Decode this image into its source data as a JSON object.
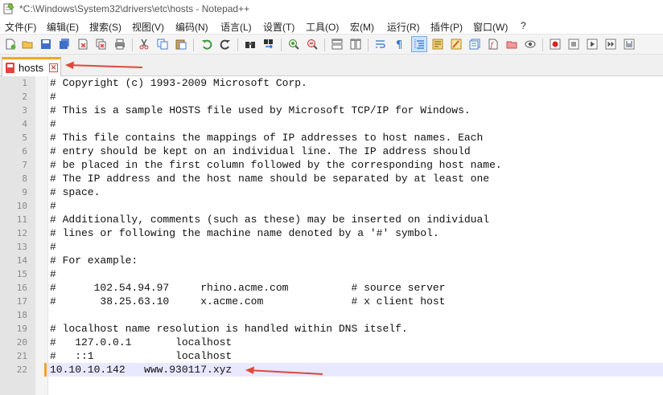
{
  "window": {
    "title": "*C:\\Windows\\System32\\drivers\\etc\\hosts - Notepad++",
    "icon": "notepadpp-icon"
  },
  "menu": [
    {
      "label": "文件(F)"
    },
    {
      "label": "编辑(E)"
    },
    {
      "label": "搜索(S)"
    },
    {
      "label": "视图(V)"
    },
    {
      "label": "编码(N)"
    },
    {
      "label": "语言(L)"
    },
    {
      "label": "设置(T)"
    },
    {
      "label": "工具(O)"
    },
    {
      "label": "宏(M)"
    },
    {
      "label": "运行(R)"
    },
    {
      "label": "插件(P)"
    },
    {
      "label": "窗口(W)"
    },
    {
      "label": "?"
    }
  ],
  "toolbar_icons": [
    "new-file-icon",
    "open-file-icon",
    "save-icon",
    "save-all-icon",
    "close-icon",
    "close-all-icon",
    "print-icon",
    "cut-icon",
    "copy-icon",
    "paste-icon",
    "undo-icon",
    "redo-icon",
    "find-icon",
    "replace-icon",
    "zoom-in-icon",
    "zoom-out-icon",
    "sync-vertical-icon",
    "sync-horizontal-icon",
    "word-wrap-icon",
    "show-all-chars-icon",
    "indent-guide-icon",
    "udl-icon",
    "doc-map-icon",
    "function-list-icon",
    "folder-workspace-icon",
    "doc-list-icon",
    "monitor-icon",
    "record-macro-icon",
    "stop-record-icon",
    "play-macro-icon",
    "run-macro-multiple-icon",
    "save-macro-icon"
  ],
  "colors": {
    "accent_tab": "#f5a623",
    "annotation_arrow": "#e0483a",
    "current_line": "#e8e8ff"
  },
  "tab": {
    "label": "hosts",
    "icon": "unsaved-file-icon",
    "close_icon": "tab-close-icon",
    "close_glyph": "✕"
  },
  "editor": {
    "lines": [
      {
        "n": "1",
        "text": "# Copyright (c) 1993-2009 Microsoft Corp."
      },
      {
        "n": "2",
        "text": "#"
      },
      {
        "n": "3",
        "text": "# This is a sample HOSTS file used by Microsoft TCP/IP for Windows."
      },
      {
        "n": "4",
        "text": "#"
      },
      {
        "n": "5",
        "text": "# This file contains the mappings of IP addresses to host names. Each"
      },
      {
        "n": "6",
        "text": "# entry should be kept on an individual line. The IP address should"
      },
      {
        "n": "7",
        "text": "# be placed in the first column followed by the corresponding host name."
      },
      {
        "n": "8",
        "text": "# The IP address and the host name should be separated by at least one"
      },
      {
        "n": "9",
        "text": "# space."
      },
      {
        "n": "10",
        "text": "#"
      },
      {
        "n": "11",
        "text": "# Additionally, comments (such as these) may be inserted on individual"
      },
      {
        "n": "12",
        "text": "# lines or following the machine name denoted by a '#' symbol."
      },
      {
        "n": "13",
        "text": "#"
      },
      {
        "n": "14",
        "text": "# For example:"
      },
      {
        "n": "15",
        "text": "#"
      },
      {
        "n": "16",
        "text": "#      102.54.94.97     rhino.acme.com          # source server"
      },
      {
        "n": "17",
        "text": "#       38.25.63.10     x.acme.com              # x client host"
      },
      {
        "n": "18",
        "text": ""
      },
      {
        "n": "19",
        "text": "# localhost name resolution is handled within DNS itself."
      },
      {
        "n": "20",
        "text": "#   127.0.0.1       localhost"
      },
      {
        "n": "21",
        "text": "#   ::1             localhost"
      },
      {
        "n": "22",
        "text": "10.10.10.142   www.930117.xyz"
      }
    ]
  }
}
